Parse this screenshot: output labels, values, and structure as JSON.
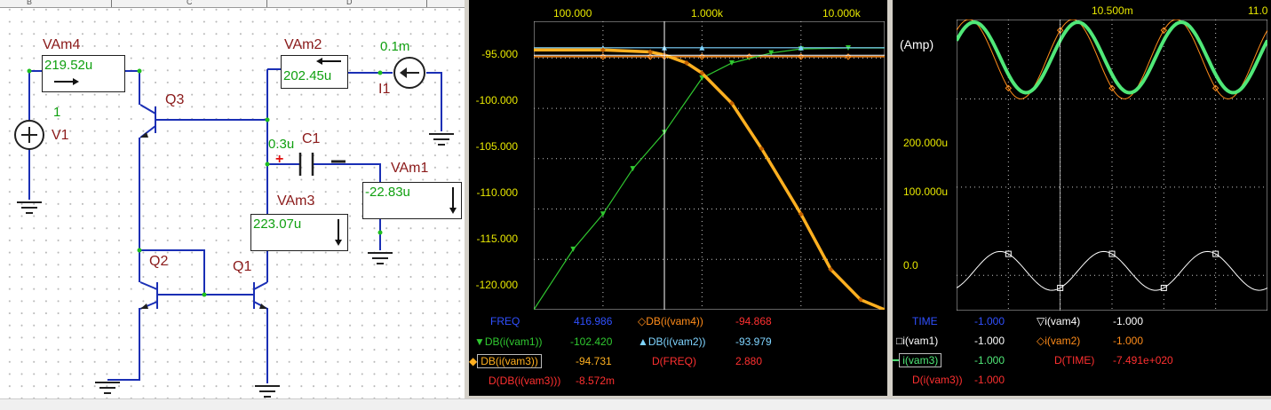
{
  "schematic": {
    "ruler_letters": [
      "B",
      "C",
      "D"
    ],
    "components": {
      "vam4": {
        "name": "VAm4",
        "reading": "219.52u"
      },
      "vam2": {
        "name": "VAm2",
        "reading": "202.45u"
      },
      "vam1": {
        "name": "VAm1",
        "reading": "-22.83u"
      },
      "vam3": {
        "name": "VAm3",
        "reading": "223.07u"
      },
      "v1": {
        "name": "V1",
        "value": "1"
      },
      "i1": {
        "name": "I1",
        "value": "0.1m"
      },
      "c1": {
        "name": "C1",
        "value": "0.3u",
        "plus": "+"
      },
      "q1": {
        "name": "Q1"
      },
      "q2": {
        "name": "Q2"
      },
      "q3": {
        "name": "Q3"
      }
    }
  },
  "ac_panel": {
    "x_tick_labels": [
      "100.000",
      "1.000k",
      "10.000k"
    ],
    "y_tick_labels": [
      "-95.000",
      "-100.000",
      "-105.000",
      "-110.000",
      "-115.000",
      "-120.000"
    ],
    "legend": {
      "freq_label": "FREQ",
      "freq_value": "416.986",
      "vam4_label": "DB(i(vam4))",
      "vam4_value": "-94.868",
      "vam1_label": "DB(i(vam1))",
      "vam1_value": "-102.420",
      "vam2_label": "DB(i(vam2))",
      "vam2_value": "-93.979",
      "vam3_label": "DB(i(vam3))",
      "vam3_value": "-94.731",
      "dfreq_label": "D(FREQ)",
      "dfreq_value": "2.880",
      "ddb_label": "D(DB(i(vam3)))",
      "ddb_value": "-8.572m"
    },
    "colors": {
      "vam4": "#ff8c1a",
      "vam1": "#30c830",
      "vam2": "#7fd4ff",
      "vam3": "#ffb020",
      "label_blue": "#3050ff",
      "label_red": "#ff3030"
    }
  },
  "tran_panel": {
    "x_tick_labels": [
      "10.500m",
      "11.0"
    ],
    "y_unit": "(Amp)",
    "y_tick_labels": [
      "200.000u",
      "100.000u",
      "0.0"
    ],
    "legend": {
      "time_label": "TIME",
      "time_value": "-1.000",
      "vam4_label": "i(vam4)",
      "vam4_value": "-1.000",
      "vam1_label": "i(vam1)",
      "vam1_value": "-1.000",
      "vam2_label": "i(vam2)",
      "vam2_value": "-1.000",
      "vam3_label": "i(vam3)",
      "vam3_value": "-1.000",
      "dtime_label": "D(TIME)",
      "dtime_value": "-7.491e+020",
      "di_label": "D(i(vam3))",
      "di_value": "-1.000"
    }
  },
  "chart_data": [
    {
      "type": "line",
      "xscale": "log",
      "x_ticks": [
        100,
        1000,
        10000
      ],
      "ylim": [
        -120,
        -94
      ],
      "series": [
        {
          "name": "DB(i(vam4))",
          "x": [
            20,
            100,
            300,
            416.986,
            1000,
            3000,
            10000,
            30000,
            70000
          ],
          "values": [
            -94.87,
            -94.87,
            -94.87,
            -94.87,
            -94.87,
            -94.87,
            -94.87,
            -94.87,
            -94.87
          ]
        },
        {
          "name": "DB(i(vam1))",
          "x": [
            20,
            50,
            100,
            200,
            416.986,
            1000,
            2000,
            5000,
            10000,
            30000,
            70000
          ],
          "values": [
            -120.0,
            -114.0,
            -110.5,
            -106.0,
            -102.4,
            -97.0,
            -95.5,
            -94.5,
            -94.1,
            -94.0,
            -94.0
          ]
        },
        {
          "name": "DB(i(vam2))",
          "x": [
            20,
            100,
            416.986,
            1000,
            10000,
            70000
          ],
          "values": [
            -93.98,
            -93.98,
            -93.98,
            -93.98,
            -93.98,
            -93.98
          ]
        },
        {
          "name": "DB(i(vam3))",
          "x": [
            20,
            100,
            300,
            416.986,
            700,
            1000,
            2000,
            4000,
            10000,
            20000,
            40000,
            70000
          ],
          "values": [
            -94.2,
            -94.2,
            -94.4,
            -94.7,
            -95.5,
            -96.5,
            -99.5,
            -104.0,
            -110.5,
            -116.0,
            -119.0,
            -120.0
          ]
        }
      ]
    },
    {
      "type": "line",
      "x_ticks_labeled": [
        "10.500m",
        "11.0"
      ],
      "ylim": [
        -40,
        290
      ],
      "series": [
        {
          "name": "i(vam4)",
          "x": [
            10.0,
            10.5,
            11.0,
            11.5
          ],
          "amplitude": 40,
          "offset": 247,
          "period": 0.5
        },
        {
          "name": "i(vam1)",
          "x": [
            10.0,
            10.5,
            11.0,
            11.5
          ],
          "amplitude": 22,
          "offset": 5,
          "period": 0.5
        },
        {
          "name": "i(vam2)",
          "x": [
            10.0,
            10.5,
            11.0,
            11.5
          ],
          "amplitude": 45,
          "offset": 245,
          "period": 0.5
        },
        {
          "name": "i(vam3)",
          "x": [
            10.0,
            10.5,
            11.0,
            11.5
          ],
          "amplitude": 40,
          "offset": 247,
          "period": 0.5
        }
      ]
    }
  ]
}
